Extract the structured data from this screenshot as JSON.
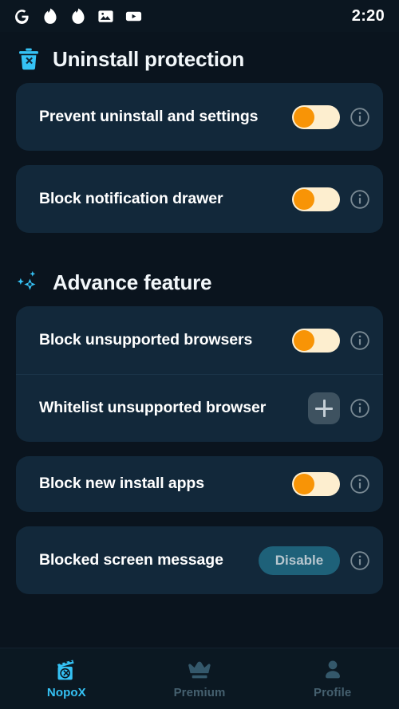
{
  "statusbar": {
    "icons": [
      "google-icon",
      "tinder-flame-icon",
      "tinder-flame-icon-2",
      "gallery-photo-icon",
      "youtube-icon"
    ],
    "clock": "2:20"
  },
  "sections": [
    {
      "icon": "trash-x-icon",
      "title": "Uninstall protection",
      "cards": [
        {
          "rows": [
            {
              "label": "Prevent uninstall and settings",
              "control": "toggle",
              "toggle_on": true,
              "info": "info-icon"
            }
          ]
        },
        {
          "rows": [
            {
              "label": "Block notification drawer",
              "control": "toggle",
              "toggle_on": true,
              "info": "info-icon"
            }
          ]
        }
      ]
    },
    {
      "icon": "sparkles-icon",
      "title": "Advance feature",
      "cards": [
        {
          "rows": [
            {
              "label": "Block unsupported browsers",
              "control": "toggle",
              "toggle_on": true,
              "info": "info-icon"
            },
            {
              "label": "Whitelist unsupported browser",
              "control": "plus",
              "plus_label": "+",
              "info": "info-icon"
            }
          ]
        },
        {
          "rows": [
            {
              "label": "Block new install apps",
              "control": "toggle",
              "toggle_on": true,
              "info": "info-icon"
            }
          ]
        },
        {
          "rows": [
            {
              "label": "Blocked screen message",
              "control": "pill",
              "pill_label": "Disable",
              "info": "info-icon"
            }
          ]
        }
      ]
    }
  ],
  "bottomnav": {
    "items": [
      {
        "icon": "nopox-clapperboard-x-icon",
        "label": "NopoX",
        "active": true
      },
      {
        "icon": "crown-icon",
        "label": "Premium",
        "active": false
      },
      {
        "icon": "person-icon",
        "label": "Profile",
        "active": false
      }
    ]
  },
  "colors": {
    "page_background": "#0a141e",
    "card_background": "#12283a",
    "accent_blue": "#35c2f5",
    "toggle_track": "#fdeecf",
    "toggle_knob": "#f89406",
    "pill_background": "#1e6179",
    "plus_background": "#3e5260",
    "info_gray": "#7a8a94",
    "nav_inactive": "#45606f"
  }
}
